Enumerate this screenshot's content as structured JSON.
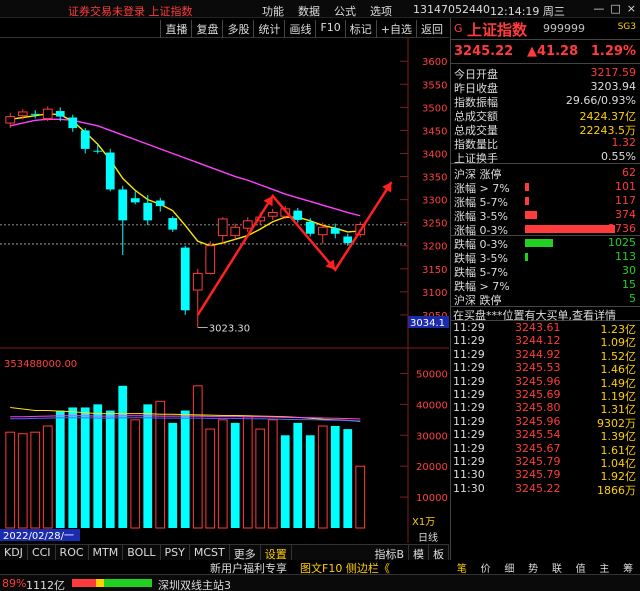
{
  "titlebar": {
    "left_text": "证券交易未登录  上证指数",
    "menu": [
      "功能",
      "数据",
      "公式",
      "选项"
    ],
    "phone": "13147052440",
    "clock": "12:14:19 周三",
    "win_buttons": [
      "—",
      "□",
      "×"
    ]
  },
  "chart_toolbar": [
    "直播",
    "复盘",
    "多股",
    "统计",
    "画线",
    "F10",
    "标记",
    "+自选",
    "返回"
  ],
  "price_axis": [
    "3600",
    "3550",
    "3500",
    "3450",
    "3400",
    "3350",
    "3300",
    "3250",
    "3200",
    "3150",
    "3100",
    "3050"
  ],
  "price_axis_current": "3034.1",
  "low_label": "3023.30",
  "volume_header": "353488000.00",
  "volume_axis": [
    "50000",
    "40000",
    "30000",
    "20000",
    "10000"
  ],
  "volume_unit": "X1万",
  "date_label": "2022/02/28/一",
  "chart_data": {
    "type": "candlestick",
    "ylim": [
      3000,
      3620
    ],
    "candles": [
      {
        "o": 3466,
        "c": 3480,
        "h": 3488,
        "l": 3455
      },
      {
        "o": 3482,
        "c": 3490,
        "h": 3496,
        "l": 3474
      },
      {
        "o": 3486,
        "c": 3484,
        "h": 3494,
        "l": 3476
      },
      {
        "o": 3476,
        "c": 3496,
        "h": 3502,
        "l": 3470
      },
      {
        "o": 3492,
        "c": 3480,
        "h": 3500,
        "l": 3470
      },
      {
        "o": 3478,
        "c": 3455,
        "h": 3484,
        "l": 3447
      },
      {
        "o": 3450,
        "c": 3410,
        "h": 3455,
        "l": 3400
      },
      {
        "o": 3406,
        "c": 3405,
        "h": 3420,
        "l": 3400
      },
      {
        "o": 3402,
        "c": 3322,
        "h": 3410,
        "l": 3318
      },
      {
        "o": 3322,
        "c": 3255,
        "h": 3330,
        "l": 3180
      },
      {
        "o": 3303,
        "c": 3294,
        "h": 3318,
        "l": 3290
      },
      {
        "o": 3293,
        "c": 3255,
        "h": 3310,
        "l": 3245
      },
      {
        "o": 3298,
        "c": 3286,
        "h": 3304,
        "l": 3274
      },
      {
        "o": 3260,
        "c": 3235,
        "h": 3264,
        "l": 3230
      },
      {
        "o": 3196,
        "c": 3060,
        "h": 3200,
        "l": 3050
      },
      {
        "o": 3104,
        "c": 3140,
        "h": 3150,
        "l": 3023
      },
      {
        "o": 3140,
        "c": 3200,
        "h": 3210,
        "l": 3138
      },
      {
        "o": 3222,
        "c": 3258,
        "h": 3262,
        "l": 3206
      },
      {
        "o": 3222,
        "c": 3240,
        "h": 3248,
        "l": 3214
      },
      {
        "o": 3238,
        "c": 3254,
        "h": 3262,
        "l": 3230
      },
      {
        "o": 3254,
        "c": 3262,
        "h": 3272,
        "l": 3244
      },
      {
        "o": 3264,
        "c": 3272,
        "h": 3280,
        "l": 3256
      },
      {
        "o": 3264,
        "c": 3280,
        "h": 3286,
        "l": 3258
      },
      {
        "o": 3276,
        "c": 3256,
        "h": 3282,
        "l": 3250
      },
      {
        "o": 3252,
        "c": 3226,
        "h": 3260,
        "l": 3220
      },
      {
        "o": 3224,
        "c": 3240,
        "h": 3250,
        "l": 3205
      },
      {
        "o": 3238,
        "c": 3226,
        "h": 3248,
        "l": 3216
      },
      {
        "o": 3220,
        "c": 3206,
        "h": 3226,
        "l": 3200
      },
      {
        "o": 3224,
        "c": 3246,
        "h": 3252,
        "l": 3218
      }
    ],
    "ma_yellow": [
      3474,
      3478,
      3482,
      3486,
      3484,
      3470,
      3446,
      3420,
      3386,
      3346,
      3320,
      3300,
      3290,
      3276,
      3244,
      3210,
      3200,
      3206,
      3214,
      3222,
      3236,
      3252,
      3262,
      3262,
      3254,
      3244,
      3238,
      3230,
      3232
    ],
    "ma_magenta": [
      3460,
      3466,
      3472,
      3474,
      3474,
      3472,
      3466,
      3460,
      3450,
      3440,
      3430,
      3420,
      3410,
      3400,
      3390,
      3380,
      3370,
      3360,
      3350,
      3342,
      3332,
      3322,
      3312,
      3304,
      3296,
      3288,
      3280,
      3272,
      3265
    ],
    "volumes": [
      31000,
      30500,
      31000,
      33000,
      38000,
      39000,
      39000,
      40000,
      38000,
      46000,
      35000,
      40000,
      41000,
      34000,
      38000,
      46000,
      32000,
      35000,
      34000,
      36000,
      32000,
      35000,
      30000,
      34000,
      30000,
      33000,
      33000,
      32000,
      20000
    ],
    "volume_up": [
      true,
      true,
      true,
      true,
      false,
      false,
      false,
      false,
      false,
      false,
      true,
      false,
      true,
      false,
      false,
      true,
      true,
      true,
      false,
      true,
      true,
      true,
      false,
      false,
      false,
      true,
      false,
      false,
      true
    ],
    "vol_ma1": [
      39000,
      38500,
      38000,
      38000,
      37800,
      37600,
      37300,
      37000,
      37000,
      37000,
      37000,
      37000,
      36800,
      36800,
      36700,
      36600,
      36500,
      36400,
      36400,
      36300,
      36200,
      36100,
      36000,
      35800,
      35500,
      35200,
      35000,
      34800,
      34500
    ],
    "vol_ma2": [
      36000,
      36000,
      36100,
      36200,
      36300,
      36300,
      36300,
      36200,
      36200,
      36300,
      36300,
      36300,
      36200,
      36200,
      36200,
      36200,
      36100,
      36100,
      36100,
      36000,
      36000,
      35900,
      35800,
      35700,
      35700,
      35600,
      35500,
      35400,
      35300
    ],
    "vol_ylim": [
      0,
      55000
    ],
    "annotation_path": [
      {
        "i": 15,
        "price": 3050
      },
      {
        "i": 21,
        "price": 3308
      },
      {
        "i": 26,
        "price": 3148
      },
      {
        "i": 30.5,
        "price": 3338
      }
    ],
    "hlines": [
      3245.22,
      3203.94
    ]
  },
  "quote": {
    "flag": "G",
    "name": "上证指数",
    "code": "999999",
    "sg": "SG3",
    "price": "3245.22",
    "change": "▲41.28",
    "pct": "1.29%"
  },
  "stats": [
    {
      "label": "今日开盘",
      "value": "3217.59",
      "color": "#ff3b3b"
    },
    {
      "label": "昨日收盘",
      "value": "3203.94",
      "color": "#dddddd"
    },
    {
      "label": "指数振幅",
      "value": "29.66/0.93%",
      "color": "#dddddd"
    },
    {
      "label": "总成交额",
      "value": "2424.37亿",
      "color": "#ffd000"
    },
    {
      "label": "总成交量",
      "value": "22243.5万",
      "color": "#ffd000"
    },
    {
      "label": "指数量比",
      "value": "1.32",
      "color": "#ff3b3b"
    },
    {
      "label": "上证换手",
      "value": "0.55%",
      "color": "#dddddd"
    }
  ],
  "distribution": [
    {
      "label": "沪深 涨停",
      "value": "62",
      "bar": 0,
      "color": "#ff3b3b"
    },
    {
      "label": "涨幅 > 7%",
      "value": "101",
      "bar": 4,
      "color": "#ff3b3b"
    },
    {
      "label": "涨幅 5-7%",
      "value": "117",
      "bar": 4,
      "color": "#ff3b3b"
    },
    {
      "label": "涨幅 3-5%",
      "value": "374",
      "bar": 12,
      "color": "#ff3b3b"
    },
    {
      "label": "涨幅 0-3%",
      "value": "2736",
      "bar": 90,
      "color": "#ff3b3b"
    },
    {
      "label": "跌幅 0-3%",
      "value": "1025",
      "bar": 28,
      "color": "#22d022"
    },
    {
      "label": "跌幅 3-5%",
      "value": "113",
      "bar": 3,
      "color": "#22d022"
    },
    {
      "label": "跌幅 5-7%",
      "value": "30",
      "bar": 0,
      "color": "#22d022"
    },
    {
      "label": "跌幅 > 7%",
      "value": "15",
      "bar": 0,
      "color": "#22d022"
    },
    {
      "label": "沪深 跌停",
      "value": "5",
      "bar": 0,
      "color": "#22d022"
    }
  ],
  "ticks_title": "在买盘***位置有大买单,查看详情",
  "ticks": [
    {
      "t": "11:29",
      "p": "3243.61",
      "v": "1.23亿"
    },
    {
      "t": "11:29",
      "p": "3244.12",
      "v": "1.09亿"
    },
    {
      "t": "11:29",
      "p": "3244.92",
      "v": "1.52亿"
    },
    {
      "t": "11:29",
      "p": "3245.53",
      "v": "1.46亿"
    },
    {
      "t": "11:29",
      "p": "3245.96",
      "v": "1.49亿"
    },
    {
      "t": "11:29",
      "p": "3245.69",
      "v": "1.19亿"
    },
    {
      "t": "11:29",
      "p": "3245.80",
      "v": "1.31亿"
    },
    {
      "t": "11:29",
      "p": "3245.96",
      "v": "9302万"
    },
    {
      "t": "11:29",
      "p": "3245.54",
      "v": "1.39亿"
    },
    {
      "t": "11:29",
      "p": "3245.67",
      "v": "1.61亿"
    },
    {
      "t": "11:29",
      "p": "3245.79",
      "v": "1.04亿"
    },
    {
      "t": "11:30",
      "p": "3245.79",
      "v": "1.92亿"
    },
    {
      "t": "11:30",
      "p": "3245.22",
      "v": "1866万"
    }
  ],
  "bottom_tabs": [
    "KDJ",
    "CCI",
    "ROC",
    "MTM",
    "BOLL",
    "PSY",
    "MCST",
    "更多",
    "设置"
  ],
  "bottom_tabs_right": [
    "指标B",
    "模",
    "板"
  ],
  "bottom_right_label": "日线",
  "infobar": {
    "left": "新用户福利专享",
    "right": "图文F10 侧边栏《"
  },
  "panel_tabs": [
    "笔",
    "价",
    "细",
    "势",
    "联",
    "值",
    "主",
    "筹"
  ],
  "statusbar": {
    "pct": "89%",
    "amount": "1112亿",
    "station": "深圳双线主站3"
  }
}
